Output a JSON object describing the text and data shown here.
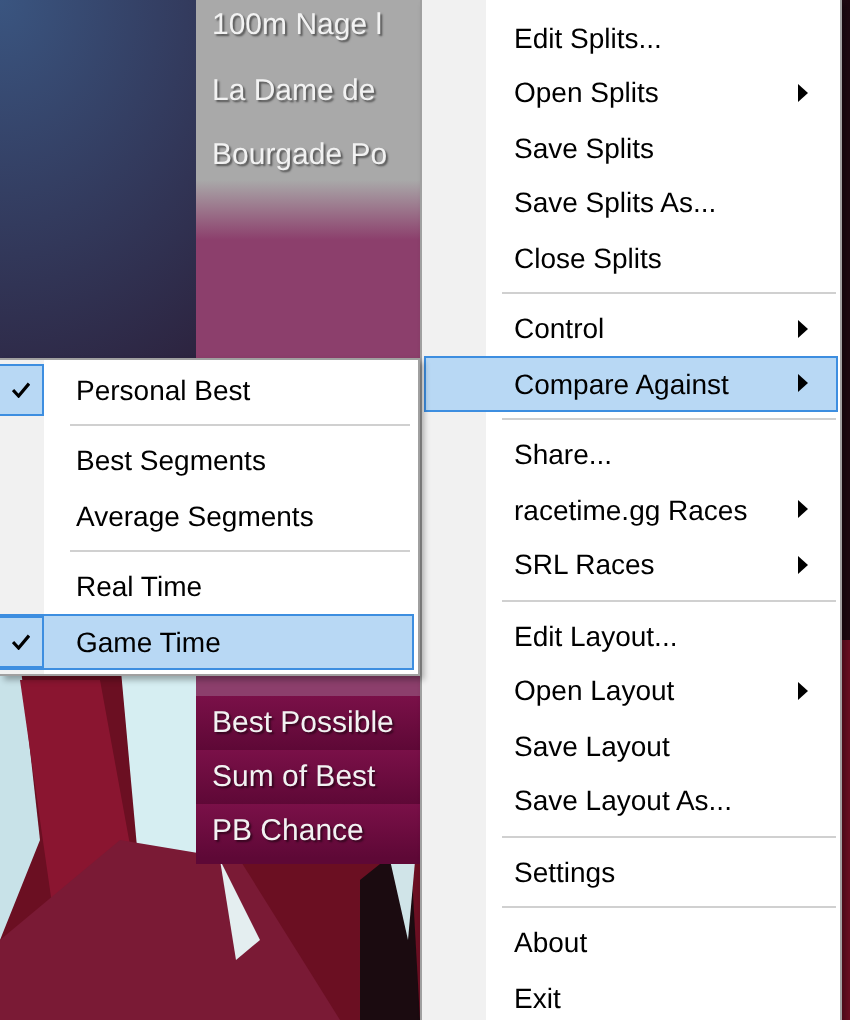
{
  "splits_panel": {
    "rows": [
      {
        "text": "100m Nage l",
        "kind": "top"
      },
      {
        "text": "La Dame de",
        "kind": "top"
      },
      {
        "text": "Bourgade Po",
        "kind": "top"
      },
      {
        "text": "Best Possible",
        "kind": "bottom"
      },
      {
        "text": "Sum of Best",
        "kind": "bottom"
      },
      {
        "text": "PB Chance",
        "kind": "bottom"
      }
    ]
  },
  "context_menu": {
    "items": [
      {
        "kind": "item",
        "label": "Edit Splits...",
        "submenu": false,
        "highlighted": false
      },
      {
        "kind": "item",
        "label": "Open Splits",
        "submenu": true,
        "highlighted": false
      },
      {
        "kind": "item",
        "label": "Save Splits",
        "submenu": false,
        "highlighted": false
      },
      {
        "kind": "item",
        "label": "Save Splits As...",
        "submenu": false,
        "highlighted": false
      },
      {
        "kind": "item",
        "label": "Close Splits",
        "submenu": false,
        "highlighted": false
      },
      {
        "kind": "separator"
      },
      {
        "kind": "item",
        "label": "Control",
        "submenu": true,
        "highlighted": false
      },
      {
        "kind": "item",
        "label": "Compare Against",
        "submenu": true,
        "highlighted": true
      },
      {
        "kind": "separator"
      },
      {
        "kind": "item",
        "label": "Share...",
        "submenu": false,
        "highlighted": false
      },
      {
        "kind": "item",
        "label": "racetime.gg Races",
        "submenu": true,
        "highlighted": false
      },
      {
        "kind": "item",
        "label": "SRL Races",
        "submenu": true,
        "highlighted": false
      },
      {
        "kind": "separator"
      },
      {
        "kind": "item",
        "label": "Edit Layout...",
        "submenu": false,
        "highlighted": false
      },
      {
        "kind": "item",
        "label": "Open Layout",
        "submenu": true,
        "highlighted": false
      },
      {
        "kind": "item",
        "label": "Save Layout",
        "submenu": false,
        "highlighted": false
      },
      {
        "kind": "item",
        "label": "Save Layout As...",
        "submenu": false,
        "highlighted": false
      },
      {
        "kind": "separator"
      },
      {
        "kind": "item",
        "label": "Settings",
        "submenu": false,
        "highlighted": false
      },
      {
        "kind": "separator"
      },
      {
        "kind": "item",
        "label": "About",
        "submenu": false,
        "highlighted": false
      },
      {
        "kind": "item",
        "label": "Exit",
        "submenu": false,
        "highlighted": false
      }
    ]
  },
  "compare_submenu": {
    "items": [
      {
        "kind": "item",
        "label": "Personal Best",
        "checked": true,
        "selected": false
      },
      {
        "kind": "separator"
      },
      {
        "kind": "item",
        "label": "Best Segments",
        "checked": false,
        "selected": false
      },
      {
        "kind": "item",
        "label": "Average Segments",
        "checked": false,
        "selected": false
      },
      {
        "kind": "separator"
      },
      {
        "kind": "item",
        "label": "Real Time",
        "checked": false,
        "selected": false
      },
      {
        "kind": "item",
        "label": "Game Time",
        "checked": true,
        "selected": true
      }
    ]
  }
}
